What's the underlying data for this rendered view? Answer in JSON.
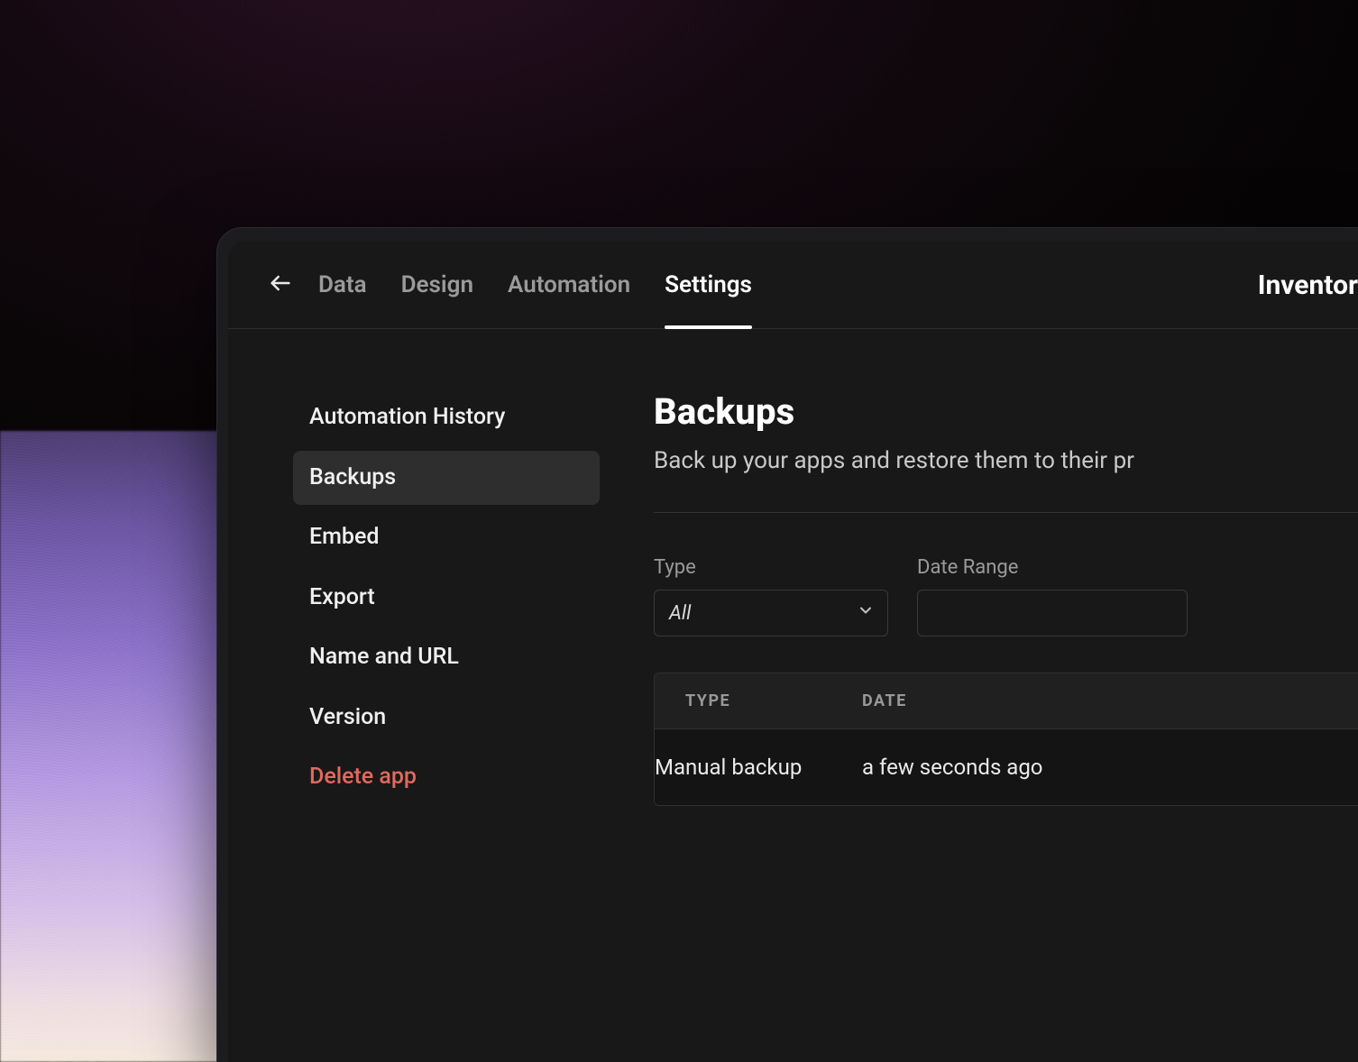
{
  "header": {
    "tabs": [
      "Data",
      "Design",
      "Automation",
      "Settings"
    ],
    "active_tab": "Settings",
    "app_title": "Inventor"
  },
  "sidebar": {
    "items": [
      {
        "label": "Automation History",
        "active": false,
        "danger": false
      },
      {
        "label": "Backups",
        "active": true,
        "danger": false
      },
      {
        "label": "Embed",
        "active": false,
        "danger": false
      },
      {
        "label": "Export",
        "active": false,
        "danger": false
      },
      {
        "label": "Name and URL",
        "active": false,
        "danger": false
      },
      {
        "label": "Version",
        "active": false,
        "danger": false
      },
      {
        "label": "Delete app",
        "active": false,
        "danger": true
      }
    ]
  },
  "main": {
    "title": "Backups",
    "description": "Back up your apps and restore them to their pr",
    "filters": {
      "type_label": "Type",
      "type_value": "All",
      "date_range_label": "Date Range",
      "date_range_value": ""
    },
    "table": {
      "columns": [
        "TYPE",
        "DATE"
      ],
      "rows": [
        {
          "type": "Manual backup",
          "date": "a few seconds ago"
        }
      ]
    }
  }
}
